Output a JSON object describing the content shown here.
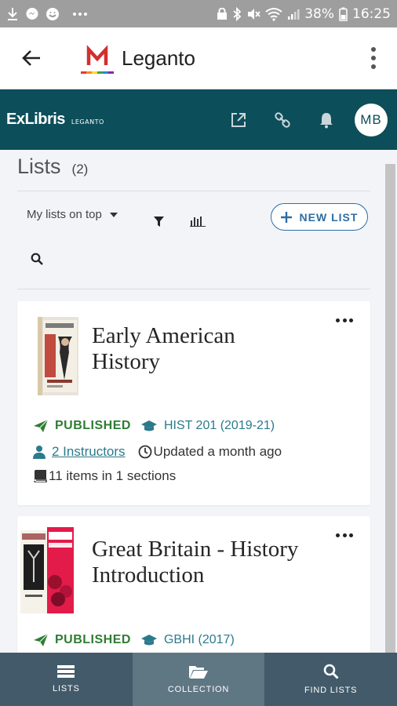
{
  "status_bar": {
    "battery": "38%",
    "time": "16:25"
  },
  "app_bar": {
    "title": "Leganto"
  },
  "header": {
    "brand": "ExLibris",
    "brand_sub": "LEGANTO",
    "avatar_initials": "MB"
  },
  "lists": {
    "title": "Lists",
    "count": "(2)",
    "sort_label": "My lists on top",
    "new_list_label": "NEW LIST"
  },
  "cards": [
    {
      "title_line1": "Early American",
      "title_line2": "History",
      "status": "PUBLISHED",
      "course": "HIST 201 (2019-21)",
      "instructors": "2 Instructors",
      "updated": "Updated a month ago",
      "items": "11 items in 1 sections"
    },
    {
      "title_line1": "Great Britain - History",
      "title_line2": "Introduction",
      "status": "PUBLISHED",
      "course": "GBHI (2017)"
    }
  ],
  "bottom_nav": [
    {
      "label": "LISTS"
    },
    {
      "label": "COLLECTION"
    },
    {
      "label": "FIND LISTS"
    }
  ],
  "colors": {
    "header_bg": "#0c4e59",
    "accent_blue": "#2e6da4",
    "published_green": "#2e7d32",
    "link_teal": "#2b7a8c",
    "nav_bg": "#425a69",
    "nav_active": "#5f7683"
  },
  "icons": {
    "status_left": [
      "download-icon",
      "messenger-icon",
      "face-icon",
      "more-dots-icon"
    ],
    "status_right": [
      "lock-icon",
      "bluetooth-icon",
      "mute-icon",
      "wifi-icon",
      "signal-icon",
      "battery-icon"
    ],
    "header": [
      "external-link-icon",
      "link-icon",
      "bell-icon"
    ]
  }
}
